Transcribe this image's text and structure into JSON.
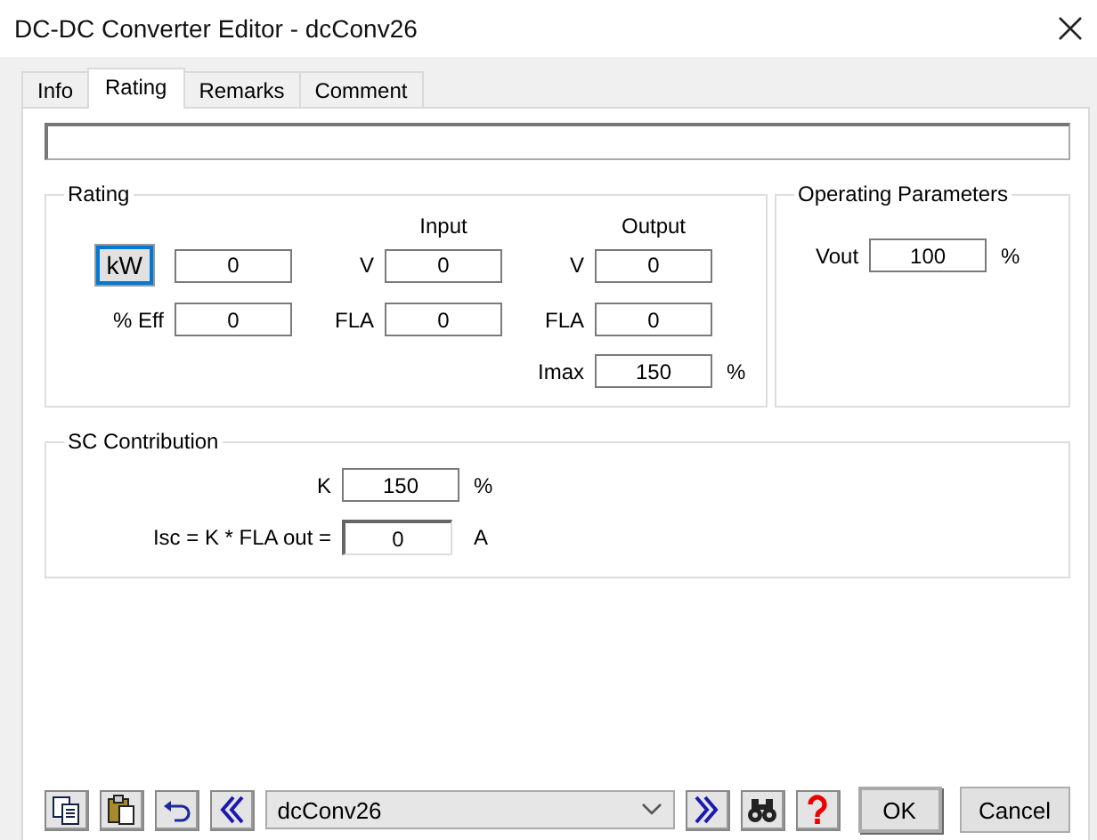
{
  "window": {
    "title": "DC-DC Converter Editor - dcConv26"
  },
  "tabs": [
    {
      "label": "Info",
      "selected": false
    },
    {
      "label": "Rating",
      "selected": true
    },
    {
      "label": "Remarks",
      "selected": false
    },
    {
      "label": "Comment",
      "selected": false
    }
  ],
  "rating": {
    "title": "Rating",
    "headers": [
      "Input",
      "Output"
    ],
    "rows": [
      {
        "kind": "button",
        "label": "kW",
        "cells": [
          {
            "value": "0"
          },
          {
            "label": "V",
            "value": "0"
          },
          {
            "label": "V",
            "value": "0"
          }
        ]
      },
      {
        "kind": "text",
        "label": "% Eff",
        "cells": [
          {
            "value": "0"
          },
          {
            "label": "FLA",
            "value": "0"
          },
          {
            "label": "FLA",
            "value": "0"
          }
        ]
      }
    ],
    "imax": {
      "label": "Imax",
      "value": "150",
      "unit": "%"
    }
  },
  "operating_parameters": {
    "title": "Operating Parameters",
    "fields": [
      {
        "label": "Vout",
        "value": "100",
        "unit": "%"
      }
    ]
  },
  "sc_contribution": {
    "title": "SC Contribution",
    "fields": [
      {
        "kind": "input",
        "label": "K",
        "value": "150",
        "unit": "%"
      },
      {
        "kind": "display",
        "label": "Isc = K * FLA out =",
        "value": "0",
        "unit": "A"
      }
    ]
  },
  "toolbar": {
    "combo_value": "dcConv26"
  },
  "buttons": [
    {
      "label": "OK",
      "default": true
    },
    {
      "label": "Cancel",
      "default": false
    }
  ]
}
